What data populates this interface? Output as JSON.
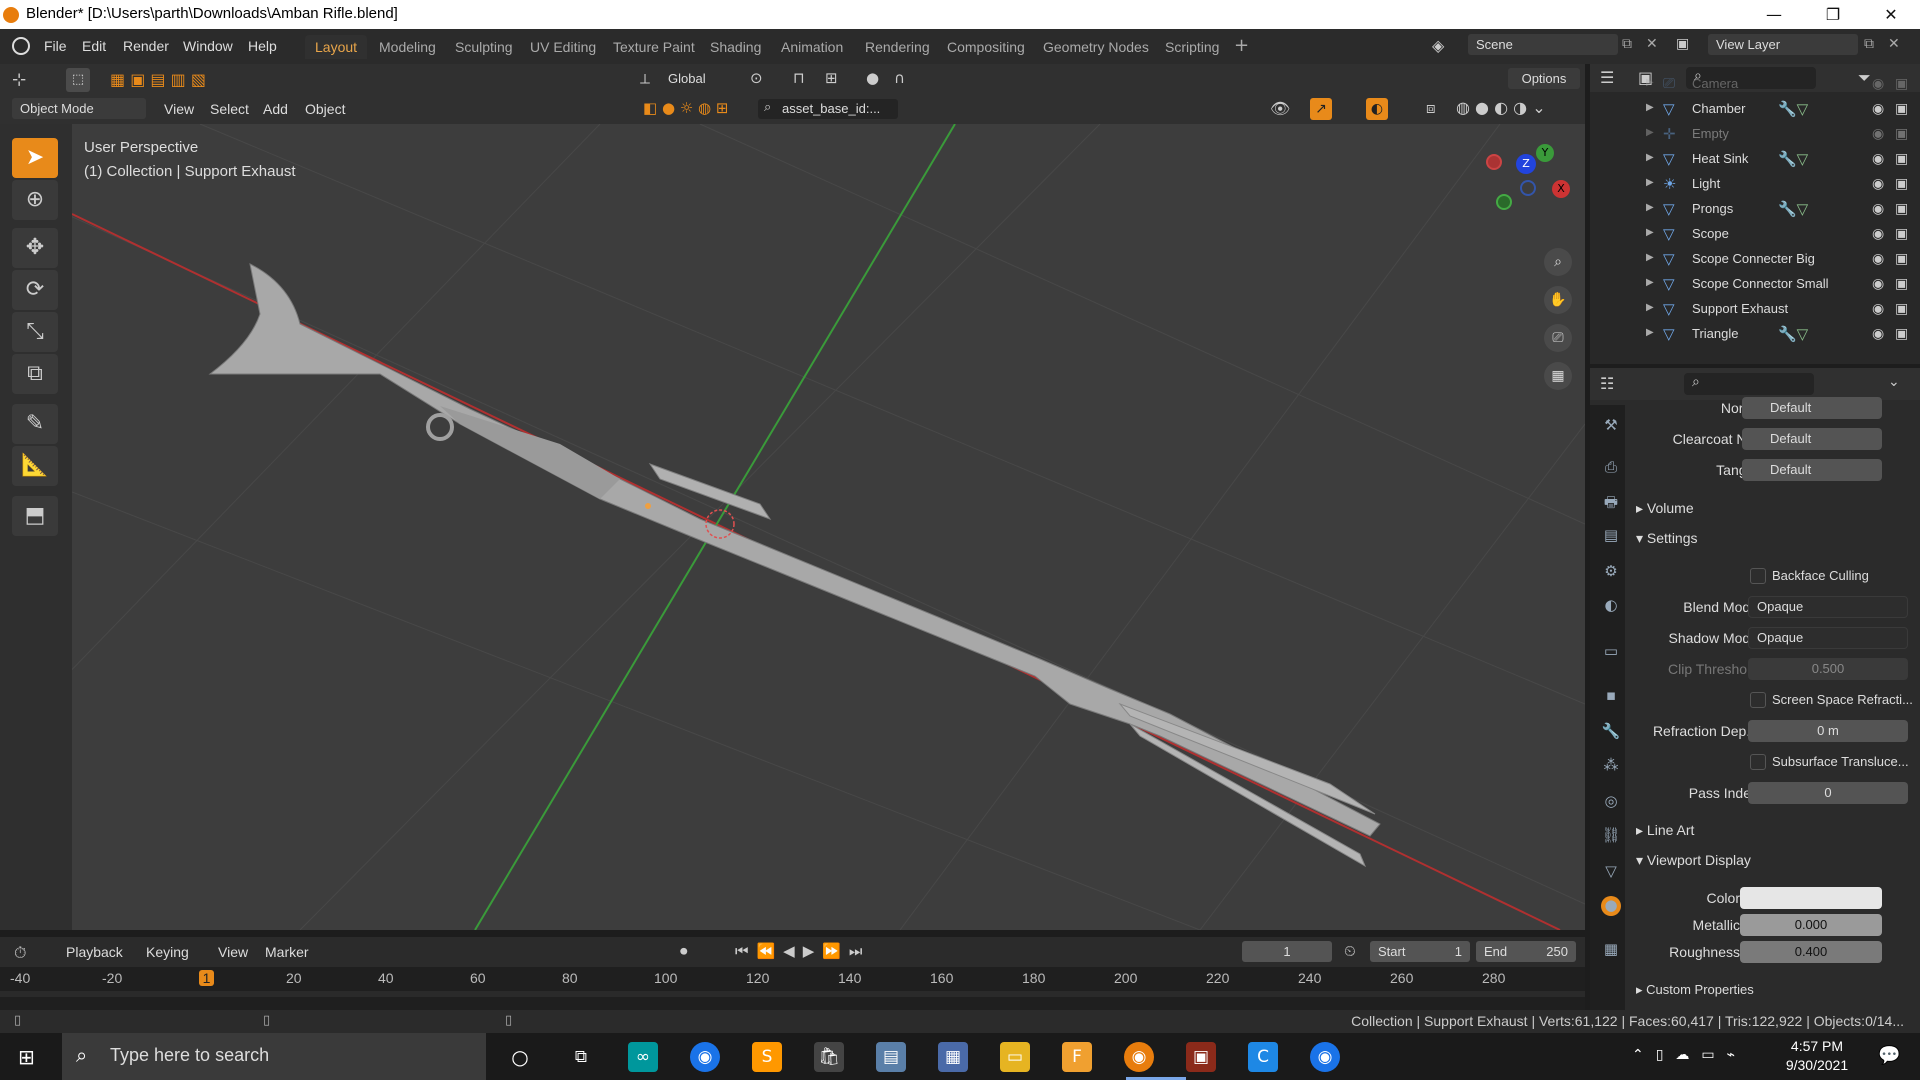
{
  "window": {
    "title": "Blender* [D:\\Users\\parth\\Downloads\\Amban Rifle.blend]",
    "minimize": "—",
    "maximize": "❐",
    "close": "✕"
  },
  "menu": [
    "File",
    "Edit",
    "Render",
    "Window",
    "Help"
  ],
  "workspaces": [
    "Layout",
    "Modeling",
    "Sculpting",
    "UV Editing",
    "Texture Paint",
    "Shading",
    "Animation",
    "Rendering",
    "Compositing",
    "Geometry Nodes",
    "Scripting"
  ],
  "scene": {
    "value": "Scene"
  },
  "view_layer": {
    "value": "View Layer"
  },
  "viewport_header": {
    "transform_orientation": "Global",
    "options": "Options",
    "mode": "Object Mode",
    "menus": [
      "View",
      "Select",
      "Add",
      "Object"
    ],
    "filter": "asset_base_id:..."
  },
  "viewport": {
    "perspective": "User Perspective",
    "collection_info": "(1) Collection | Support Exhaust",
    "axes": {
      "x": "X",
      "y": "Y",
      "z": "Z"
    }
  },
  "outliner": {
    "items": [
      {
        "name": "Camera",
        "icon": "camera-icon",
        "dim": false
      },
      {
        "name": "Chamber",
        "icon": "mesh-icon",
        "mods": true,
        "dim": false
      },
      {
        "name": "Empty",
        "icon": "empty-icon",
        "dim": true
      },
      {
        "name": "Heat Sink",
        "icon": "mesh-icon",
        "mods": true,
        "dim": false
      },
      {
        "name": "Light",
        "icon": "light-icon",
        "dim": false
      },
      {
        "name": "Prongs",
        "icon": "mesh-icon",
        "mods": true,
        "dim": false
      },
      {
        "name": "Scope",
        "icon": "mesh-icon",
        "dim": false
      },
      {
        "name": "Scope Connecter Big",
        "icon": "mesh-icon",
        "dim": false
      },
      {
        "name": "Scope Connector Small",
        "icon": "mesh-icon",
        "dim": false
      },
      {
        "name": "Support Exhaust",
        "icon": "mesh-icon",
        "dim": false
      },
      {
        "name": "Triangle",
        "icon": "mesh-icon",
        "mods": true,
        "dim": false
      }
    ]
  },
  "properties": {
    "normal": {
      "label": "Normal",
      "value": "Default"
    },
    "clearcoat": {
      "label": "Clearcoat No...",
      "value": "Default"
    },
    "tangent": {
      "label": "Tangent",
      "value": "Default"
    },
    "volume": "Volume",
    "settings": "Settings",
    "backface_culling": "Backface Culling",
    "blend_mode": {
      "label": "Blend Mode",
      "value": "Opaque"
    },
    "shadow_mode": {
      "label": "Shadow Mode",
      "value": "Opaque"
    },
    "clip_threshold": {
      "label": "Clip Threshold",
      "value": "0.500"
    },
    "ssr": "Screen Space Refracti...",
    "refraction_depth": {
      "label": "Refraction Dep...",
      "value": "0 m"
    },
    "subsurface": "Subsurface Transluce...",
    "pass_index": {
      "label": "Pass Index",
      "value": "0"
    },
    "line_art": "Line Art",
    "viewport_display": "Viewport Display",
    "color": {
      "label": "Color",
      "value": "#e6e6e6"
    },
    "metallic": {
      "label": "Metallic",
      "value": "0.000",
      "fraction": 0.0
    },
    "roughness": {
      "label": "Roughness",
      "value": "0.400",
      "fraction": 0.4
    },
    "custom_properties": "Custom Properties"
  },
  "timeline": {
    "menus": [
      "Playback",
      "Keying",
      "View",
      "Marker"
    ],
    "current_frame": "1",
    "start_label": "Start",
    "start": "1",
    "end_label": "End",
    "end": "250",
    "ticks": [
      "-40",
      "-20",
      "1",
      "20",
      "40",
      "60",
      "80",
      "100",
      "120",
      "140",
      "160",
      "180",
      "200",
      "220",
      "240",
      "260",
      "280"
    ]
  },
  "status": "Collection | Support Exhaust | Verts:61,122 | Faces:60,417 | Tris:122,922 | Objects:0/14...",
  "taskbar": {
    "search_placeholder": "Type here to search",
    "time": "4:57 PM",
    "date": "9/30/2021"
  },
  "colors": {
    "accent": "#e88a1a",
    "active_tab": "#e8a54a",
    "viewport_bg": "#3d3d3d",
    "grid_x": "#b03030",
    "grid_y": "#3a9a3a"
  }
}
